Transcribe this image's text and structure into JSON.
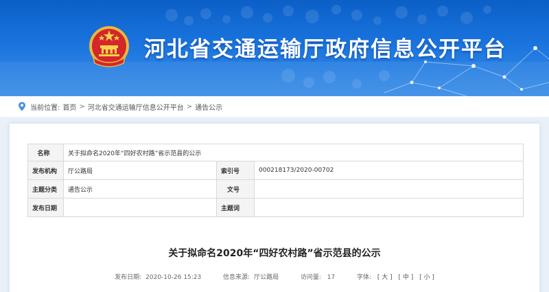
{
  "header": {
    "site_title": "河北省交通运输厅政府信息公开平台",
    "colors": {
      "banner_top": "#0b5fc7",
      "banner_bottom": "#3b8ee8",
      "title": "#ffffff"
    },
    "emblem_icon": "national-emblem"
  },
  "breadcrumb": {
    "prefix": "当前位置:",
    "items": [
      "首页",
      "河北省交通运输厅信息公开平台",
      "通告公示"
    ],
    "separator": ">"
  },
  "meta_table": {
    "name_label": "名称",
    "name_value": "关于拟命名2020年“四好农村路”省示范县的公示",
    "publisher_label": "发布机构",
    "publisher_value": "厅公路局",
    "index_label": "索引号",
    "index_value": "000218173/2020-00702",
    "category_label": "主题分类",
    "category_value": "通告公示",
    "doc_no_label": "文号",
    "doc_no_value": "",
    "date_label": "发布日期",
    "date_value": "",
    "keywords_label": "主题词",
    "keywords_value": ""
  },
  "article": {
    "title": "关于拟命名2020年“四好农村路”省示范县的公示",
    "publish_date_label": "发布日期:",
    "publish_date": "2020-10-26 15:23",
    "source_label": "信息来源:",
    "source": "厅公路局",
    "views_label": "访问量:",
    "views": "17",
    "font_label": "字体:",
    "font_large": "[ 大 ]",
    "font_medium": "[ 中 ]",
    "font_small": "[ 小 ]"
  }
}
